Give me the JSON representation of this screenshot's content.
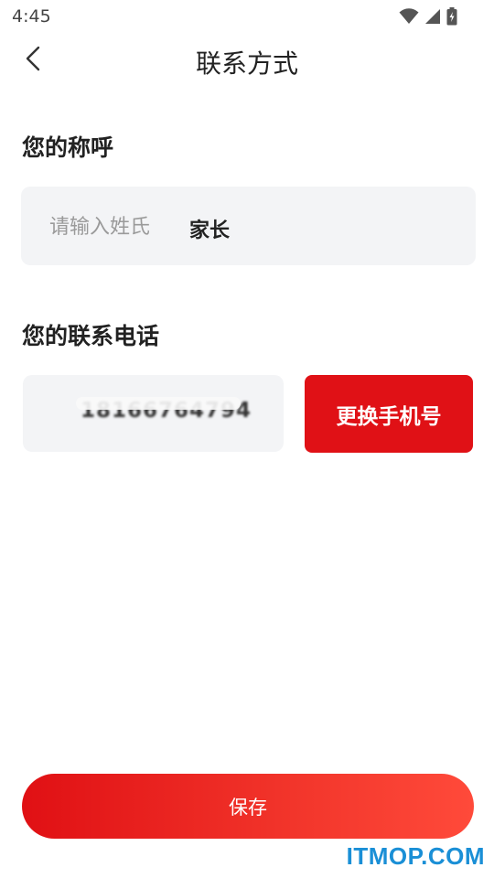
{
  "status_bar": {
    "time": "4:45",
    "icons": [
      "wifi-icon",
      "signal-icon",
      "battery-charging-icon"
    ]
  },
  "header": {
    "back_icon": "chevron-left-icon",
    "title": "联系方式"
  },
  "name_section": {
    "label": "您的称呼",
    "placeholder": "请输入姓氏",
    "value": "家长"
  },
  "phone_section": {
    "label": "您的联系电话",
    "value": "18166764794",
    "change_button_label": "更换手机号"
  },
  "footer": {
    "save_label": "保存"
  },
  "watermark": "ITMOP.COM",
  "colors": {
    "accent": "#e01116",
    "field_background": "#f3f4f6",
    "watermark": "#1a8fd6"
  }
}
